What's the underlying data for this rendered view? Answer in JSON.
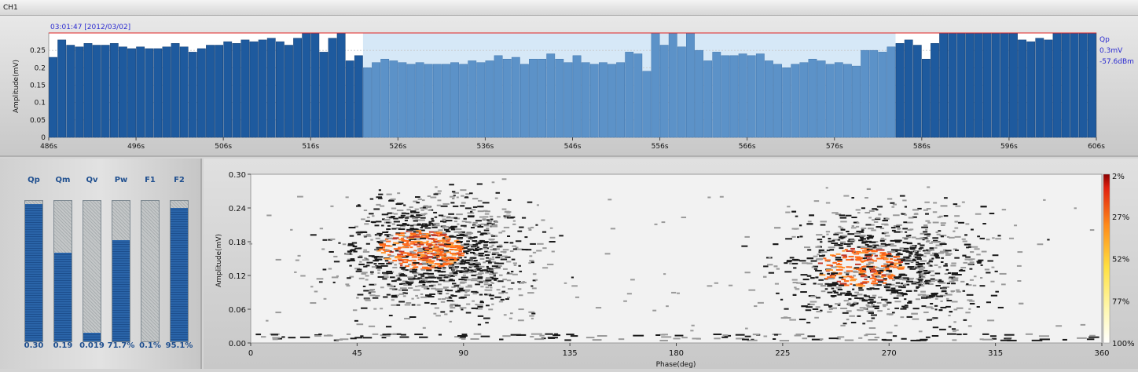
{
  "window": {
    "title": "CH1"
  },
  "trend_chart": {
    "timestamp": "03:01:47 [2012/03/02]",
    "side_labels": [
      "Qp",
      "0.3mV",
      "-57.6dBm"
    ],
    "colors": {
      "dark": "#1e5a9e",
      "light": "#5c92c8",
      "selection_bg": "#d6e8f7",
      "limit_line": "#e02020",
      "label": "#2a2ad0"
    }
  },
  "stats": {
    "items": [
      {
        "label": "Qp",
        "value": "0.30",
        "fraction": 0.98
      },
      {
        "label": "Qm",
        "value": "0.19",
        "fraction": 0.63
      },
      {
        "label": "Qv",
        "value": "0.019",
        "fraction": 0.06
      },
      {
        "label": "Pw",
        "value": "71.7%",
        "fraction": 0.72
      },
      {
        "label": "F1",
        "value": "0.1%",
        "fraction": 0.0
      },
      {
        "label": "F2",
        "value": "95.1%",
        "fraction": 0.95
      }
    ]
  },
  "prpd": {
    "colorbar_labels": [
      "2%",
      "27%",
      "52%",
      "77%",
      "100%"
    ],
    "colors": [
      "#ffffff",
      "#f0f0f0",
      "#9a9a9a",
      "#1a1a1a",
      "#c0392b",
      "#ff6a1a",
      "#ff9933"
    ]
  },
  "chart_data": [
    {
      "type": "bar",
      "xlabel": "",
      "ylabel": "Amplitude(mV)",
      "x_tick_labels": [
        "486s",
        "496s",
        "506s",
        "516s",
        "526s",
        "536s",
        "546s",
        "556s",
        "566s",
        "576s",
        "586s",
        "596s",
        "606s"
      ],
      "y_tick_labels": [
        "0",
        "0.05",
        "0.1",
        "0.15",
        "0.2",
        "0.25"
      ],
      "xlim": [
        486,
        606
      ],
      "ylim": [
        0,
        0.3
      ],
      "limit_line": 0.3,
      "selection_range": [
        522,
        583
      ],
      "x": [
        486,
        487,
        488,
        489,
        490,
        491,
        492,
        493,
        494,
        495,
        496,
        497,
        498,
        499,
        500,
        501,
        502,
        503,
        504,
        505,
        506,
        507,
        508,
        509,
        510,
        511,
        512,
        513,
        514,
        515,
        516,
        517,
        518,
        519,
        520,
        521,
        522,
        523,
        524,
        525,
        526,
        527,
        528,
        529,
        530,
        531,
        532,
        533,
        534,
        535,
        536,
        537,
        538,
        539,
        540,
        541,
        542,
        543,
        544,
        545,
        546,
        547,
        548,
        549,
        550,
        551,
        552,
        553,
        554,
        555,
        556,
        557,
        558,
        559,
        560,
        561,
        562,
        563,
        564,
        565,
        566,
        567,
        568,
        569,
        570,
        571,
        572,
        573,
        574,
        575,
        576,
        577,
        578,
        579,
        580,
        581,
        582,
        583,
        584,
        585,
        586,
        587,
        588,
        589,
        590,
        591,
        592,
        593,
        594,
        595,
        596,
        597,
        598,
        599,
        600,
        601,
        602,
        603,
        604,
        605
      ],
      "values": [
        0.23,
        0.28,
        0.265,
        0.26,
        0.27,
        0.265,
        0.265,
        0.27,
        0.26,
        0.255,
        0.26,
        0.255,
        0.255,
        0.26,
        0.27,
        0.26,
        0.245,
        0.255,
        0.265,
        0.265,
        0.275,
        0.27,
        0.28,
        0.275,
        0.28,
        0.285,
        0.275,
        0.265,
        0.285,
        0.3,
        0.3,
        0.245,
        0.285,
        0.3,
        0.22,
        0.235,
        0.2,
        0.215,
        0.225,
        0.22,
        0.215,
        0.21,
        0.215,
        0.21,
        0.21,
        0.21,
        0.215,
        0.21,
        0.22,
        0.215,
        0.22,
        0.235,
        0.225,
        0.23,
        0.21,
        0.225,
        0.225,
        0.24,
        0.225,
        0.215,
        0.235,
        0.215,
        0.21,
        0.215,
        0.21,
        0.215,
        0.245,
        0.24,
        0.19,
        0.3,
        0.265,
        0.3,
        0.26,
        0.3,
        0.25,
        0.22,
        0.245,
        0.235,
        0.235,
        0.24,
        0.235,
        0.24,
        0.22,
        0.21,
        0.2,
        0.21,
        0.215,
        0.225,
        0.22,
        0.21,
        0.215,
        0.21,
        0.205,
        0.25,
        0.25,
        0.245,
        0.26,
        0.27,
        0.28,
        0.265,
        0.225,
        0.27,
        0.3,
        0.3,
        0.3,
        0.3,
        0.3,
        0.3,
        0.3,
        0.3,
        0.3,
        0.28,
        0.275,
        0.285,
        0.28,
        0.3,
        0.3,
        0.3,
        0.3,
        0.3,
        0.3,
        0.3,
        0.3,
        0.3,
        0.3,
        0.3,
        0.3,
        0.3,
        0.3,
        0.3,
        0.3,
        0.3,
        0.3,
        0.3,
        0.3,
        0.3,
        0.3,
        0.3,
        0.3,
        0.3,
        0.3
      ]
    },
    {
      "type": "heatmap",
      "xlabel": "Phase(deg)",
      "ylabel": "Amplitude(mV)",
      "x_tick_labels": [
        "0",
        "45",
        "90",
        "135",
        "180",
        "225",
        "270",
        "315",
        "360"
      ],
      "y_tick_labels": [
        "0.00",
        "0.06",
        "0.12",
        "0.18",
        "0.24",
        "0.30"
      ],
      "xlim": [
        0,
        360
      ],
      "ylim": [
        0,
        0.3
      ],
      "clusters": [
        {
          "phase_center": 80,
          "phase_width": 35,
          "amp_center": 0.16,
          "amp_width": 0.055,
          "peak_phase": 72,
          "peak_amp": 0.165
        },
        {
          "phase_center": 270,
          "phase_width": 40,
          "amp_center": 0.14,
          "amp_width": 0.055,
          "peak_phase": 258,
          "peak_amp": 0.135
        }
      ]
    }
  ]
}
